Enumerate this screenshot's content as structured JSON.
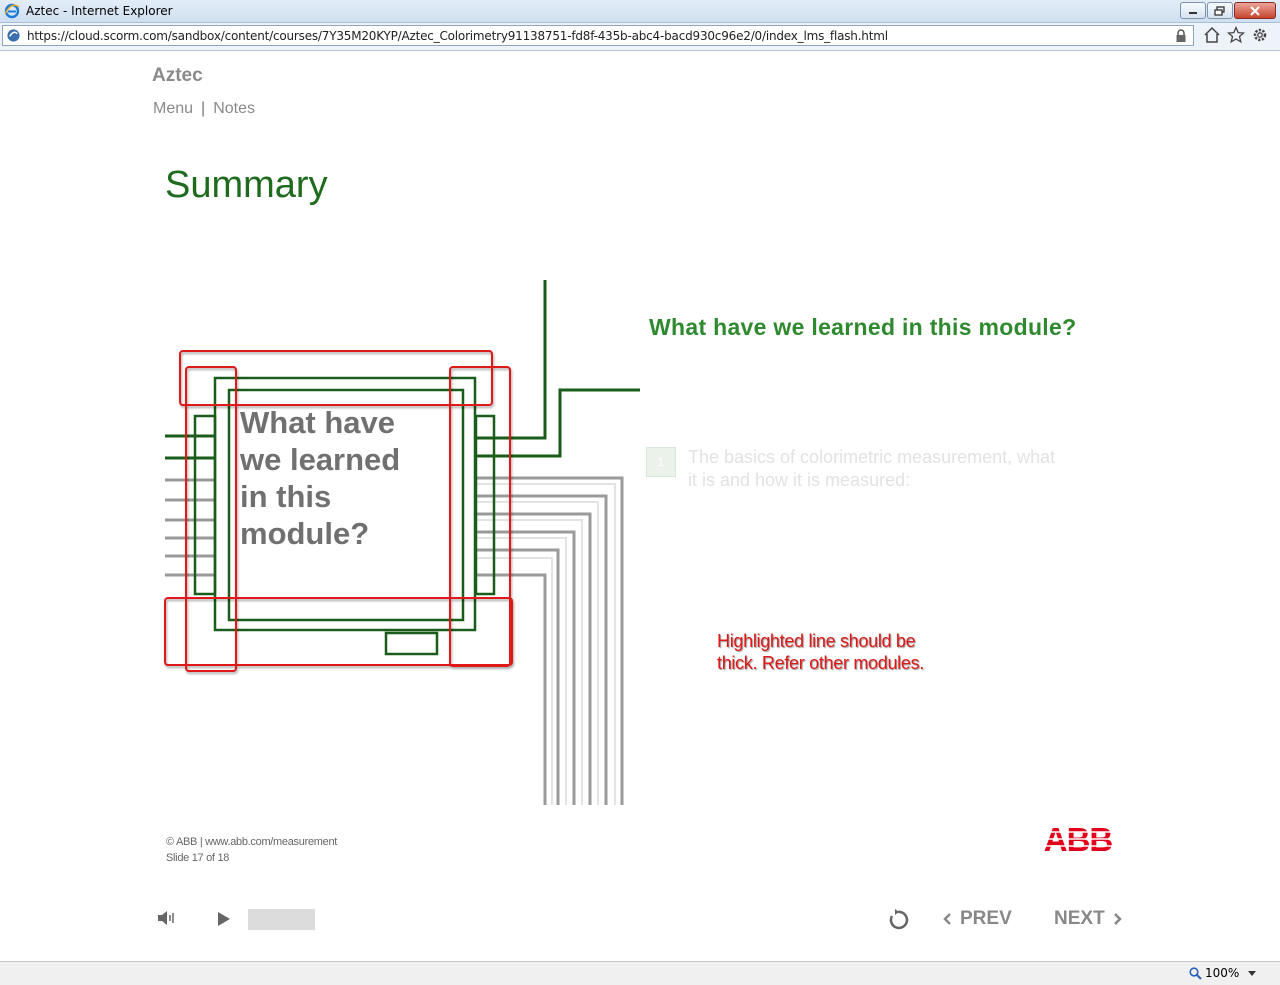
{
  "browser": {
    "window_title": "Aztec - Internet Explorer",
    "url": "https://cloud.scorm.com/sandbox/content/courses/7Y35M20KYP/Aztec_Colorimetry91138751-fd8f-435b-abc4-bacd930c96e2/0/index_lms_flash.html",
    "icons": [
      "ie-logo-icon",
      "minimize-icon",
      "restore-icon",
      "close-icon",
      "site-icon",
      "lock-icon",
      "home-icon",
      "favorites-star-icon",
      "settings-gear-icon"
    ],
    "zoom": "100%"
  },
  "course": {
    "title": "Aztec",
    "nav": {
      "menu": "Menu",
      "separator": "|",
      "notes": "Notes"
    }
  },
  "slide": {
    "title": "Summary",
    "diagram_text": "What have we learned in this module?",
    "question": "What have we learned in this module?",
    "bullet_number": "1",
    "bullet_text": "The basics of colorimetric measurement, what it is and how it is measured:",
    "review_note": "Highlighted line should be thick. Refer other modules."
  },
  "footer": {
    "copyright": "© ABB | www.abb.com/measurement",
    "slide_counter": "Slide 17 of 18",
    "logo_text": "ABB"
  },
  "player": {
    "prev_label": "PREV",
    "next_label": "NEXT",
    "progress_fraction": 0.0,
    "icons": [
      "speaker-icon",
      "play-icon",
      "replay-icon",
      "chevron-left-icon",
      "chevron-right-icon"
    ]
  },
  "colors": {
    "title_green": "#1e6b1e",
    "question_green": "#2f8a2f",
    "review_red": "#e01818",
    "abb_red": "#e2001a",
    "muted_gray": "#8a8a8a"
  }
}
